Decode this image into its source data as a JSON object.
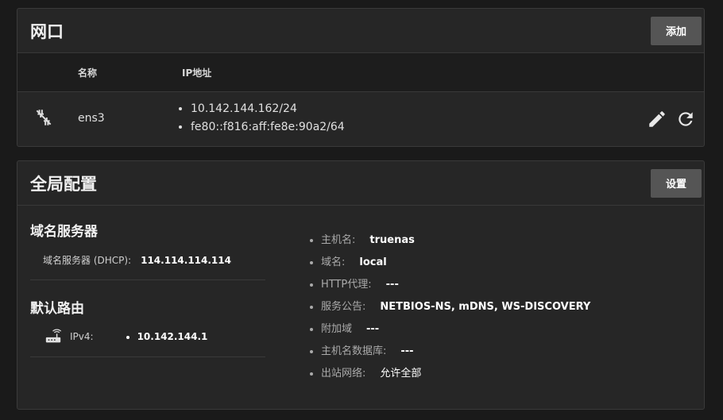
{
  "interfaces": {
    "title": "网口",
    "add_label": "添加",
    "columns": {
      "name": "名称",
      "ip": "IP地址"
    },
    "row": {
      "name": "ens3",
      "ips": [
        "10.142.144.162/24",
        "fe80::f816:aff:fe8e:90a2/64"
      ],
      "status_icon": "ethernet-off-icon",
      "edit_icon": "pencil-icon",
      "reset_icon": "refresh-icon"
    }
  },
  "global": {
    "title": "全局配置",
    "settings_label": "设置",
    "dns": {
      "title": "域名服务器",
      "label": "域名服务器 (DHCP):",
      "value": "114.114.114.114"
    },
    "route": {
      "title": "默认路由",
      "icon": "router-icon",
      "label": "IPv4:",
      "value": "10.142.144.1"
    },
    "details": [
      {
        "label": "主机名:",
        "value": "truenas"
      },
      {
        "label": "域名:",
        "value": "local"
      },
      {
        "label": "HTTP代理:",
        "value": "---"
      },
      {
        "label": "服务公告:",
        "value": "NETBIOS-NS, mDNS, WS-DISCOVERY"
      },
      {
        "label": "附加域",
        "value": "---"
      },
      {
        "label": "主机名数据库:",
        "value": "---"
      },
      {
        "label": "出站网络:",
        "value": "允许全部"
      }
    ]
  },
  "colors": {
    "background": "#1a1a1a",
    "card": "#262626",
    "button": "#555555"
  }
}
